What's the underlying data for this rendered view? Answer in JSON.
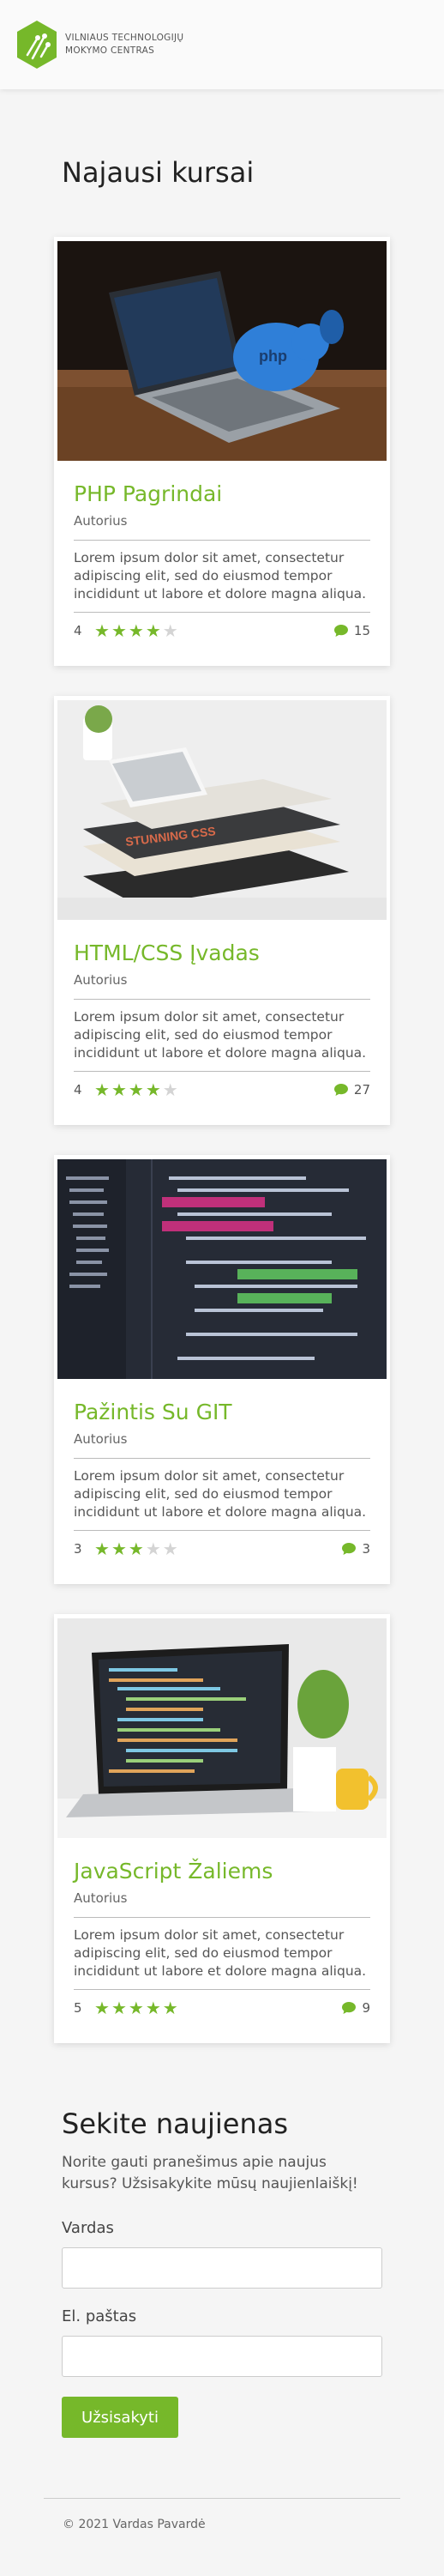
{
  "header": {
    "logo_line1": "VILNIAUS TECHNOLOGIJŲ",
    "logo_line2": "MOKYMO CENTRAS",
    "brand_color": "#76b82a"
  },
  "courses_title": "Najausi kursai",
  "courses": [
    {
      "title": "PHP Pagrindai",
      "author": "Autorius",
      "description": "Lorem ipsum dolor sit amet, consectetur adipiscing elit, sed do eiusmod tempor incididunt ut labore et dolore magna aliqua.",
      "rating": 4,
      "comments": 15,
      "image": "laptop with php elephant"
    },
    {
      "title": "HTML/CSS Įvadas",
      "author": "Autorius",
      "description": "Lorem ipsum dolor sit amet, consectetur adipiscing elit, sed do eiusmod tempor incididunt ut labore et dolore magna aliqua.",
      "rating": 4,
      "comments": 27,
      "image": "stack of css books"
    },
    {
      "title": "Pažintis Su GIT",
      "author": "Autorius",
      "description": "Lorem ipsum dolor sit amet, consectetur adipiscing elit, sed do eiusmod tempor incididunt ut labore et dolore magna aliqua.",
      "rating": 3,
      "comments": 3,
      "image": "code editor screen"
    },
    {
      "title": "JavaScript Žaliems",
      "author": "Autorius",
      "description": "Lorem ipsum dolor sit amet, consectetur adipiscing elit, sed do eiusmod tempor incididunt ut labore et dolore magna aliqua.",
      "rating": 5,
      "comments": 9,
      "image": "laptop with code and mug"
    }
  ],
  "newsletter": {
    "title": "Sekite naujienas",
    "text": "Norite gauti pranešimus apie naujus kursus? Užsisakykite mūsų naujienlaiškį!",
    "name_label": "Vardas",
    "email_label": "El. paštas",
    "button_label": "Užsisakyti"
  },
  "footer": {
    "text": "© 2021 Vardas Pavardė"
  }
}
